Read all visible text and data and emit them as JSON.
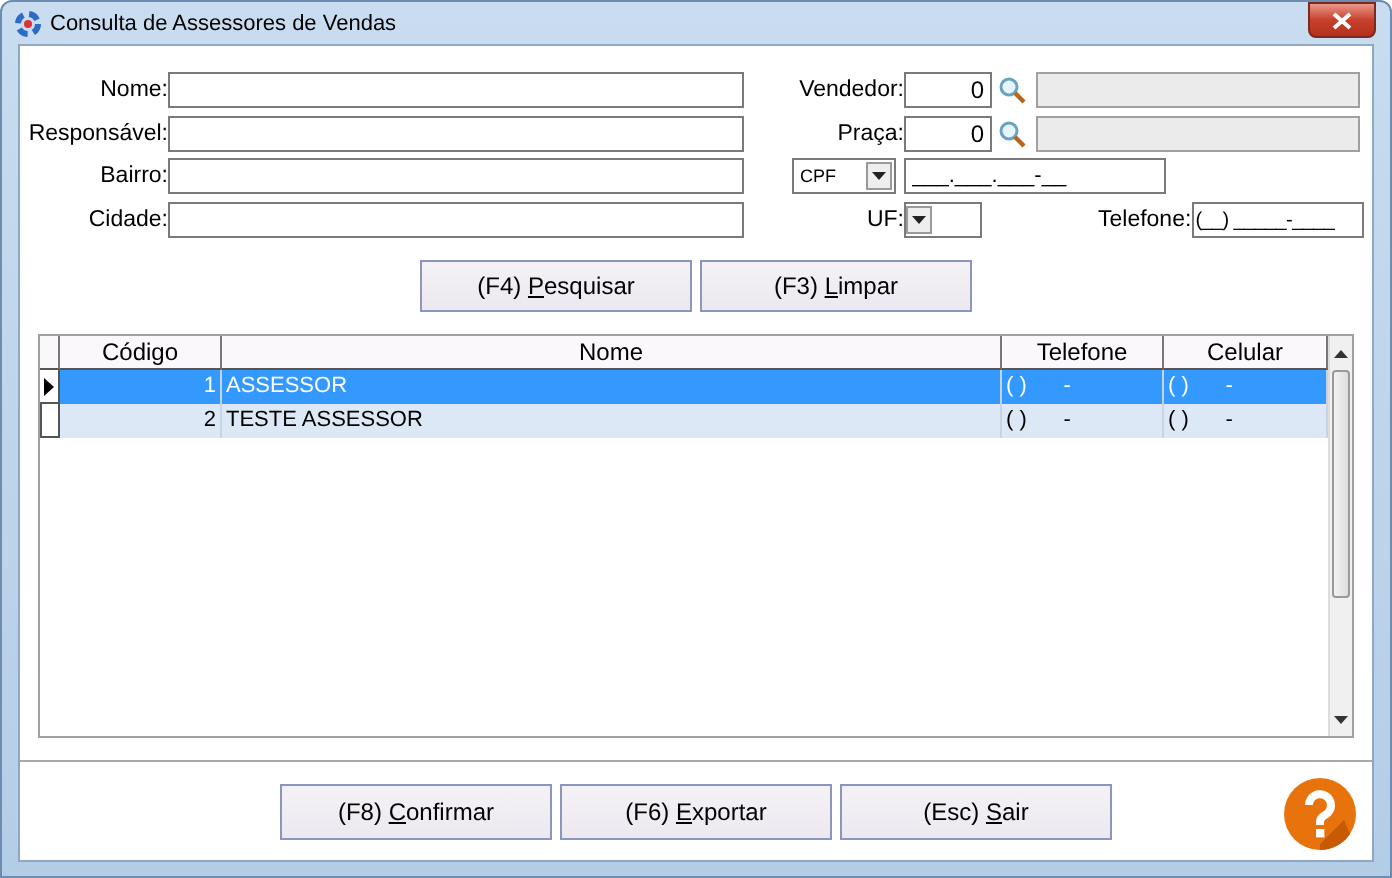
{
  "window": {
    "title": "Consulta de Assessores de Vendas"
  },
  "filters_left": [
    {
      "label": "Nome:"
    },
    {
      "label": "Responsável:"
    },
    {
      "label": "Bairro:"
    },
    {
      "label": "Cidade:"
    }
  ],
  "vendedor": {
    "label": "Vendedor:",
    "value": "0"
  },
  "praca": {
    "label": "Praça:",
    "value": "0"
  },
  "document": {
    "type": "CPF",
    "value": "___.___.___-__"
  },
  "uf": {
    "label": "UF:"
  },
  "telefone": {
    "label": "Telefone:",
    "value": "(__) _____-____"
  },
  "search_buttons": [
    {
      "before": "(F4) ",
      "accelerator": "P",
      "after": "esquisar"
    },
    {
      "before": "(F3) ",
      "accelerator": "L",
      "after": "impar"
    }
  ],
  "table": {
    "columns": [
      "Código",
      "Nome",
      "Telefone",
      "Celular"
    ],
    "rows": [
      {
        "selected": true,
        "cells": [
          "1",
          "ASSESSOR",
          "( )      -",
          "( )      -"
        ]
      },
      {
        "selected": false,
        "cells": [
          "2",
          "TESTE ASSESSOR",
          "( )      -",
          "( )      -"
        ]
      }
    ]
  },
  "action_buttons": [
    {
      "before": "(F8) ",
      "accelerator": "C",
      "after": "onfirmar"
    },
    {
      "before": "(F6) ",
      "accelerator": "E",
      "after": "xportar"
    },
    {
      "before": "(Esc) ",
      "accelerator": "S",
      "after": "air"
    }
  ]
}
